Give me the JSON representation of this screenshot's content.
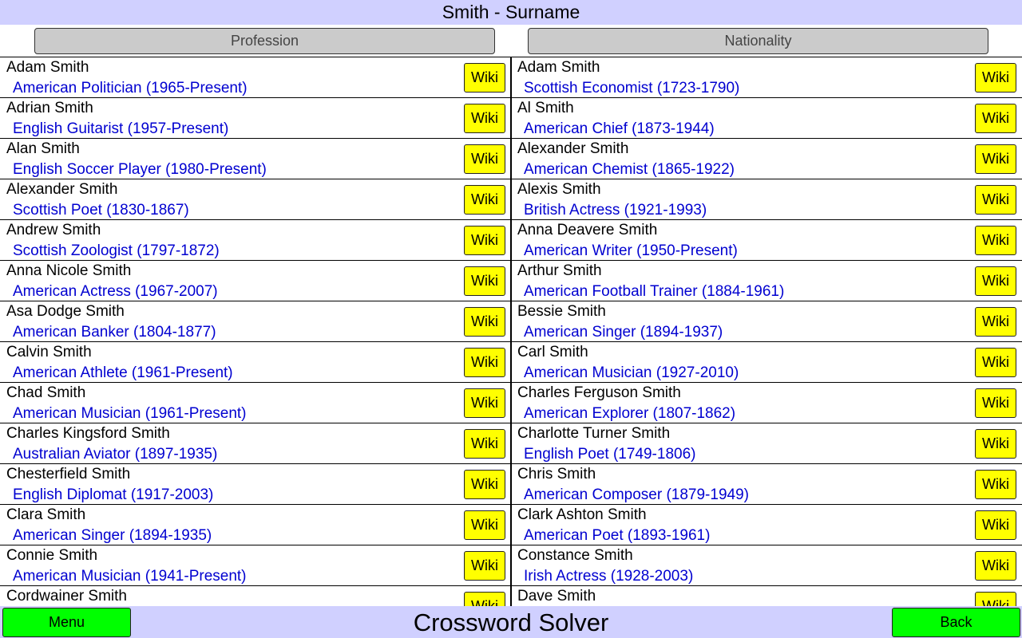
{
  "title": "Smith - Surname",
  "columns": {
    "left_label": "Profession",
    "right_label": "Nationality"
  },
  "wiki_label": "Wiki",
  "left_list": [
    {
      "name": "Adam Smith",
      "desc": "American Politician (1965-Present)"
    },
    {
      "name": "Adrian Smith",
      "desc": "English Guitarist (1957-Present)"
    },
    {
      "name": "Alan Smith",
      "desc": "English Soccer Player (1980-Present)"
    },
    {
      "name": "Alexander Smith",
      "desc": "Scottish Poet (1830-1867)"
    },
    {
      "name": "Andrew Smith",
      "desc": "Scottish Zoologist (1797-1872)"
    },
    {
      "name": "Anna Nicole Smith",
      "desc": "American Actress (1967-2007)"
    },
    {
      "name": "Asa Dodge Smith",
      "desc": "American Banker (1804-1877)"
    },
    {
      "name": "Calvin Smith",
      "desc": "American Athlete (1961-Present)"
    },
    {
      "name": "Chad Smith",
      "desc": "American Musician (1961-Present)"
    },
    {
      "name": "Charles Kingsford Smith",
      "desc": "Australian Aviator (1897-1935)"
    },
    {
      "name": "Chesterfield Smith",
      "desc": "English Diplomat (1917-2003)"
    },
    {
      "name": "Clara Smith",
      "desc": "American Singer (1894-1935)"
    },
    {
      "name": "Connie Smith",
      "desc": "American Musician (1941-Present)"
    },
    {
      "name": "Cordwainer Smith",
      "desc": ""
    }
  ],
  "right_list": [
    {
      "name": "Adam Smith",
      "desc": "Scottish Economist (1723-1790)"
    },
    {
      "name": "Al Smith",
      "desc": "American Chief (1873-1944)"
    },
    {
      "name": "Alexander Smith",
      "desc": "American Chemist (1865-1922)"
    },
    {
      "name": "Alexis Smith",
      "desc": "British Actress (1921-1993)"
    },
    {
      "name": "Anna Deavere Smith",
      "desc": "American Writer (1950-Present)"
    },
    {
      "name": "Arthur Smith",
      "desc": "American Football Trainer (1884-1961)"
    },
    {
      "name": "Bessie Smith",
      "desc": "American Singer (1894-1937)"
    },
    {
      "name": "Carl Smith",
      "desc": "American Musician (1927-2010)"
    },
    {
      "name": "Charles Ferguson Smith",
      "desc": "American Explorer (1807-1862)"
    },
    {
      "name": "Charlotte Turner Smith",
      "desc": "English Poet (1749-1806)"
    },
    {
      "name": "Chris Smith",
      "desc": "American Composer (1879-1949)"
    },
    {
      "name": "Clark Ashton Smith",
      "desc": "American Poet (1893-1961)"
    },
    {
      "name": "Constance Smith",
      "desc": "Irish Actress (1928-2003)"
    },
    {
      "name": "Dave Smith",
      "desc": ""
    }
  ],
  "bottom": {
    "menu_label": "Menu",
    "app_title": "Crossword Solver",
    "back_label": "Back"
  },
  "colors": {
    "bar_background": "#d0d0ff",
    "wiki_button": "#ffff00",
    "nav_button": "#00ff00",
    "description_text": "#0000d0"
  }
}
